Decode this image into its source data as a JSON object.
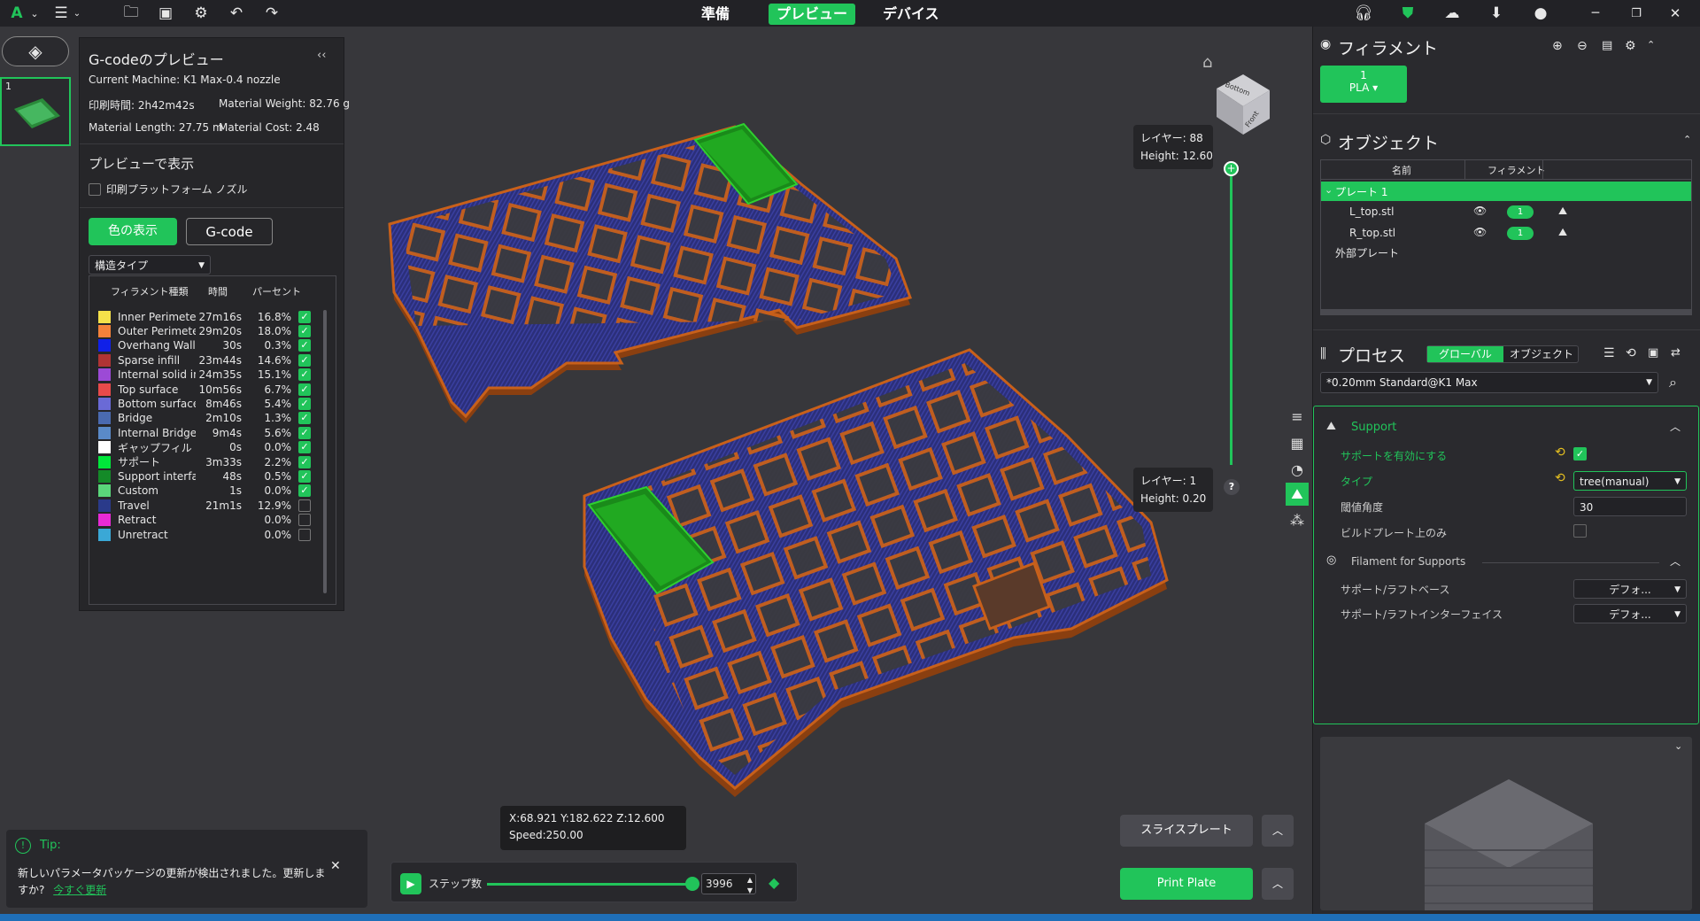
{
  "topbar": {
    "tabs": [
      {
        "label": "準備"
      },
      {
        "label": "プレビュー",
        "active": true
      },
      {
        "label": "デバイス"
      }
    ],
    "icons": [
      "logo-icon",
      "menu-icon",
      "open-folder-icon",
      "save-icon",
      "settings-icon",
      "undo-icon",
      "redo-icon",
      "headset-icon",
      "shield-icon",
      "cloud-upload-icon",
      "download-icon",
      "user-icon",
      "minimize-icon",
      "restore-icon",
      "close-icon"
    ]
  },
  "plate_thumb": {
    "number": "1"
  },
  "gcode_panel": {
    "title": "G-codeのプレビュー",
    "collapse": "‹‹",
    "machine": "Current Machine: K1 Max-0.4 nozzle",
    "print_time": "印刷時間: 2h42m42s",
    "material_weight": "Material Weight: 82.76 g",
    "material_length": "Material Length: 27.75 m",
    "material_cost": "Material Cost: 2.48",
    "show_in_preview": "プレビューで表示",
    "platform_nozzle": "印刷プラットフォーム ノズル",
    "color_display_btn": "色の表示",
    "gcode_btn": "G-code",
    "structure_type": "構造タイプ",
    "legend_headers": {
      "type": "フィラメント種類",
      "time": "時間",
      "percent": "パーセント"
    },
    "legend": [
      {
        "name": "Inner Perimeter",
        "time": "27m16s",
        "pct": "16.8%",
        "color": "#f5e14a",
        "checked": true
      },
      {
        "name": "Outer Perimeter",
        "time": "29m20s",
        "pct": "18.0%",
        "color": "#f5823a",
        "checked": true
      },
      {
        "name": "Overhang Wall",
        "time": "30s",
        "pct": "0.3%",
        "color": "#1020e8",
        "checked": true
      },
      {
        "name": "Sparse infill",
        "time": "23m44s",
        "pct": "14.6%",
        "color": "#b03434",
        "checked": true
      },
      {
        "name": "Internal solid infill",
        "time": "24m35s",
        "pct": "15.1%",
        "color": "#9c4ad6",
        "checked": true
      },
      {
        "name": "Top surface",
        "time": "10m56s",
        "pct": "6.7%",
        "color": "#e84a4a",
        "checked": true
      },
      {
        "name": "Bottom surface",
        "time": "8m46s",
        "pct": "5.4%",
        "color": "#6a6ad6",
        "checked": true
      },
      {
        "name": "Bridge",
        "time": "2m10s",
        "pct": "1.3%",
        "color": "#4a6ab0",
        "checked": true
      },
      {
        "name": "Internal Bridge",
        "time": "9m4s",
        "pct": "5.6%",
        "color": "#5a8ac8",
        "checked": true
      },
      {
        "name": "ギャップフィル",
        "time": "0s",
        "pct": "0.0%",
        "color": "#ffffff",
        "checked": true
      },
      {
        "name": "サポート",
        "time": "3m33s",
        "pct": "2.2%",
        "color": "#00e83a",
        "checked": true
      },
      {
        "name": "Support interface",
        "time": "48s",
        "pct": "0.5%",
        "color": "#148a28",
        "checked": true
      },
      {
        "name": "Custom",
        "time": "1s",
        "pct": "0.0%",
        "color": "#5ad67a",
        "checked": true
      },
      {
        "name": "Travel",
        "time": "21m1s",
        "pct": "12.9%",
        "color": "#2a3a8a",
        "checked": false
      },
      {
        "name": "Retract",
        "time": "",
        "pct": "0.0%",
        "color": "#e82ad6",
        "checked": false
      },
      {
        "name": "Unretract",
        "time": "",
        "pct": "0.0%",
        "color": "#3aa8d6",
        "checked": false
      }
    ]
  },
  "layer_slider": {
    "top_layer": "レイヤー: 88",
    "top_height": "Height: 12.60",
    "bottom_layer": "レイヤー: 1",
    "bottom_height": "Height: 0.20",
    "help": "?"
  },
  "view_cube": {
    "top": "Bottom",
    "front": "Front"
  },
  "coords": {
    "xyz": "X:68.921  Y:182.622  Z:12.600",
    "speed": "Speed:250.00"
  },
  "step_bar": {
    "label": "ステップ数",
    "value": "3996",
    "progress": 1.0
  },
  "tip": {
    "title": "Tip:",
    "text": "新しいパラメータパッケージの更新が検出されました。更新しますか?",
    "link": "今すぐ更新"
  },
  "slice_btn": "スライスプレート",
  "print_btn": "Print Plate",
  "right_panel": {
    "filament_title": "フィラメント",
    "filament_slot": {
      "num": "1",
      "type": "PLA"
    },
    "object_title": "オブジェクト",
    "object_headers": {
      "name": "名前",
      "filament": "フィラメント"
    },
    "plate_row": "プレート 1",
    "objects": [
      {
        "name": "L_top.stl",
        "filament": "1"
      },
      {
        "name": "R_top.stl",
        "filament": "1"
      }
    ],
    "external_plate": "外部プレート",
    "process_title": "プロセス",
    "process_global": "グローバル",
    "process_object": "オブジェクト",
    "preset": "*0.20mm Standard@K1 Max",
    "support_section": "Support",
    "enable_support": "サポートを有効にする",
    "type_label": "タイプ",
    "type_value": "tree(manual)",
    "threshold_label": "閾値角度",
    "threshold_value": "30",
    "build_plate_only": "ビルドプレート上のみ",
    "filament_supports": "Filament for Supports",
    "support_base": "サポート/ラフトベース",
    "support_base_value": "デフォ...",
    "support_interface": "サポート/ラフトインターフェイス",
    "support_interface_value": "デフォ..."
  }
}
